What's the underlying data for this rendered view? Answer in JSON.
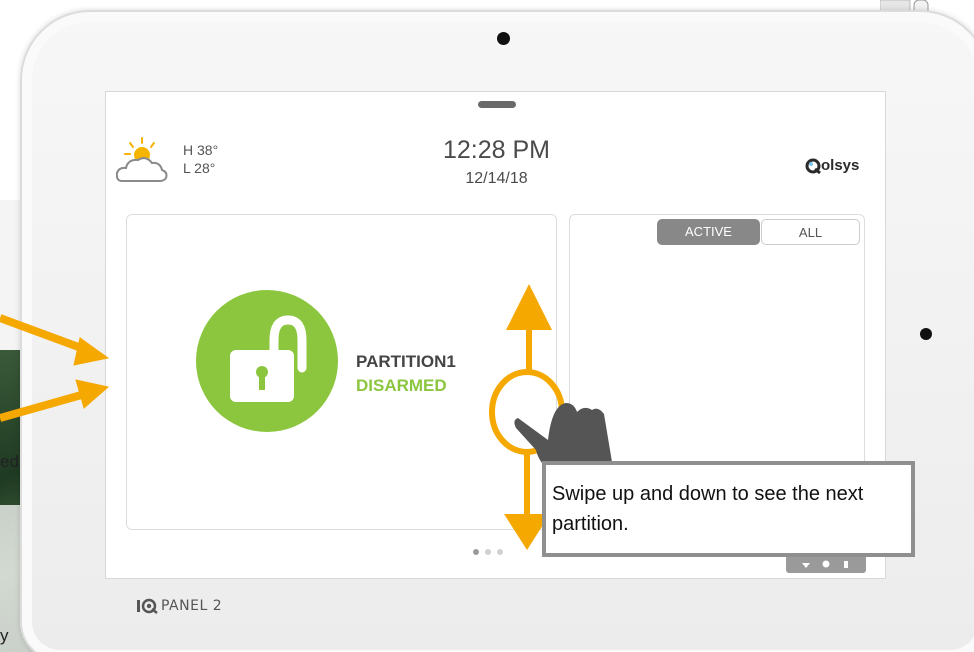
{
  "background": {
    "left_text_fragments": [
      "ed",
      "y"
    ]
  },
  "device": {
    "brand_label": "PANEL 2",
    "leds": [
      {
        "name": "led-green",
        "color": "#6ab04c"
      },
      {
        "name": "led-orange",
        "color": "#f5c07a"
      },
      {
        "name": "led-lightgreen",
        "color": "#cfeec0"
      },
      {
        "name": "led-red",
        "color": "#e0604a"
      }
    ]
  },
  "screen": {
    "weather": {
      "high": "H 38°",
      "low": "L 28°",
      "icon": "partly-cloudy-icon"
    },
    "clock": {
      "time": "12:28 PM",
      "date": "12/14/18"
    },
    "logo_text": "olsys",
    "partition": {
      "name": "PARTITION1",
      "status": "DISARMED",
      "status_color": "#8cc63f",
      "icon": "unlocked-padlock-icon"
    },
    "tabs": [
      {
        "label": "ACTIVE",
        "selected": true
      },
      {
        "label": "ALL",
        "selected": false
      }
    ],
    "page_indicator": {
      "count": 3,
      "current": 1
    }
  },
  "annotation": {
    "callout_text": "Swipe up and down to see the next partition.",
    "accent_color": "#f5a800"
  }
}
